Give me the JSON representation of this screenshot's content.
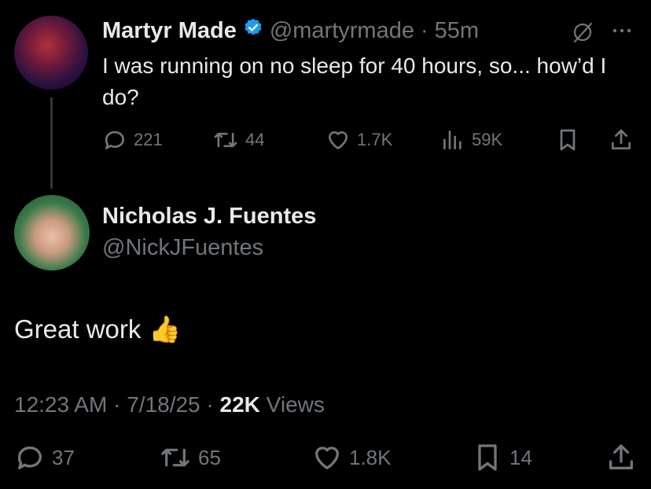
{
  "thread_tweet": {
    "display_name": "Martyr Made",
    "verified": true,
    "handle": "@martyrmade",
    "separator": "·",
    "time_ago": "55m",
    "text": "I was running on no sleep for 40 hours, so... how’d I do?",
    "stats": {
      "replies": "221",
      "reposts": "44",
      "likes": "1.7K",
      "views": "59K"
    }
  },
  "main_tweet": {
    "display_name": "Nicholas J. Fuentes",
    "handle": "@NickJFuentes",
    "text": "Great work",
    "emoji": "👍",
    "time": "12:23 AM",
    "sep1": "·",
    "date": "7/18/25",
    "sep2": "·",
    "views_count": "22K",
    "views_label": "Views",
    "stats": {
      "replies": "37",
      "reposts": "65",
      "likes": "1.8K",
      "bookmarks": "14"
    }
  },
  "icons": {
    "verified": "verified-badge-icon",
    "grok": "grok-icon",
    "more": "more-icon",
    "reply": "reply-icon",
    "repost": "repost-icon",
    "like": "like-icon",
    "views": "views-icon",
    "bookmark": "bookmark-icon",
    "share": "share-icon"
  },
  "colors": {
    "background": "#000000",
    "text": "#e7e9ea",
    "muted": "#71767b",
    "verified": "#1d9bf0"
  }
}
